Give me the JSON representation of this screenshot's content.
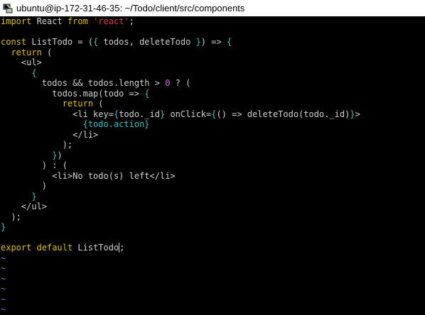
{
  "window": {
    "title": "ubuntu@ip-172-31-46-35: ~/Todo/client/src/components",
    "icon": "putty-icon"
  },
  "colors": {
    "background": "#000000",
    "text": "#d0d0d0",
    "keyword": "#e0c000",
    "string": "#e03a3a",
    "bracket": "#2ec4c4",
    "number": "#e05ae0",
    "tilde": "#5b7ed6"
  },
  "editor": {
    "lines": [
      [
        {
          "t": "import",
          "c": "keyword"
        },
        {
          "t": " React ",
          "c": "text"
        },
        {
          "t": "from",
          "c": "keyword"
        },
        {
          "t": " ",
          "c": "text"
        },
        {
          "t": "'react'",
          "c": "string"
        },
        {
          "t": ";",
          "c": "text"
        }
      ],
      [],
      [
        {
          "t": "const",
          "c": "keyword"
        },
        {
          "t": " ListTodo = (",
          "c": "text"
        },
        {
          "t": "{",
          "c": "bracket"
        },
        {
          "t": " todos, deleteTodo ",
          "c": "text"
        },
        {
          "t": "}",
          "c": "bracket"
        },
        {
          "t": ") => ",
          "c": "text"
        },
        {
          "t": "{",
          "c": "bracket"
        }
      ],
      [
        {
          "t": "  ",
          "c": "text"
        },
        {
          "t": "return",
          "c": "keyword"
        },
        {
          "t": " (",
          "c": "text"
        }
      ],
      [
        {
          "t": "    <ul>",
          "c": "text"
        }
      ],
      [
        {
          "t": "      ",
          "c": "text"
        },
        {
          "t": "{",
          "c": "bracket"
        }
      ],
      [
        {
          "t": "        todos && todos.length > ",
          "c": "text"
        },
        {
          "t": "0",
          "c": "number"
        },
        {
          "t": " ? (",
          "c": "text"
        }
      ],
      [
        {
          "t": "          todos.map(todo => ",
          "c": "text"
        },
        {
          "t": "{",
          "c": "bracket"
        }
      ],
      [
        {
          "t": "            ",
          "c": "text"
        },
        {
          "t": "return",
          "c": "keyword"
        },
        {
          "t": " (",
          "c": "text"
        }
      ],
      [
        {
          "t": "              <li key=",
          "c": "text"
        },
        {
          "t": "{",
          "c": "bracket"
        },
        {
          "t": "todo._id",
          "c": "text"
        },
        {
          "t": "}",
          "c": "bracket"
        },
        {
          "t": " onClick=",
          "c": "text"
        },
        {
          "t": "{",
          "c": "bracket"
        },
        {
          "t": "() => deleteTodo(todo._id)",
          "c": "text"
        },
        {
          "t": "}",
          "c": "bracket"
        },
        {
          "t": ">",
          "c": "text"
        }
      ],
      [
        {
          "t": "                ",
          "c": "text"
        },
        {
          "t": "{todo.action}",
          "c": "bracket"
        }
      ],
      [
        {
          "t": "              </li>",
          "c": "text"
        }
      ],
      [
        {
          "t": "            );",
          "c": "text"
        }
      ],
      [
        {
          "t": "          ",
          "c": "text"
        },
        {
          "t": "}",
          "c": "bracket"
        },
        {
          "t": ")",
          "c": "text"
        }
      ],
      [
        {
          "t": "        ) : (",
          "c": "text"
        }
      ],
      [
        {
          "t": "          <li>No todo(s) left</li>",
          "c": "text"
        }
      ],
      [
        {
          "t": "        )",
          "c": "text"
        }
      ],
      [
        {
          "t": "      ",
          "c": "text"
        },
        {
          "t": "}",
          "c": "bracket"
        }
      ],
      [
        {
          "t": "    </ul>",
          "c": "text"
        }
      ],
      [
        {
          "t": "  );",
          "c": "text"
        }
      ],
      [
        {
          "t": "}",
          "c": "bracket"
        }
      ],
      [],
      [
        {
          "t": "export",
          "c": "keyword"
        },
        {
          "t": " ",
          "c": "text"
        },
        {
          "t": "default",
          "c": "keyword"
        },
        {
          "t": " ListTodo",
          "c": "text"
        },
        {
          "t": ";",
          "c": "cursor"
        }
      ]
    ],
    "tildes": [
      "~",
      "~",
      "~",
      "~",
      "~",
      "~"
    ]
  }
}
